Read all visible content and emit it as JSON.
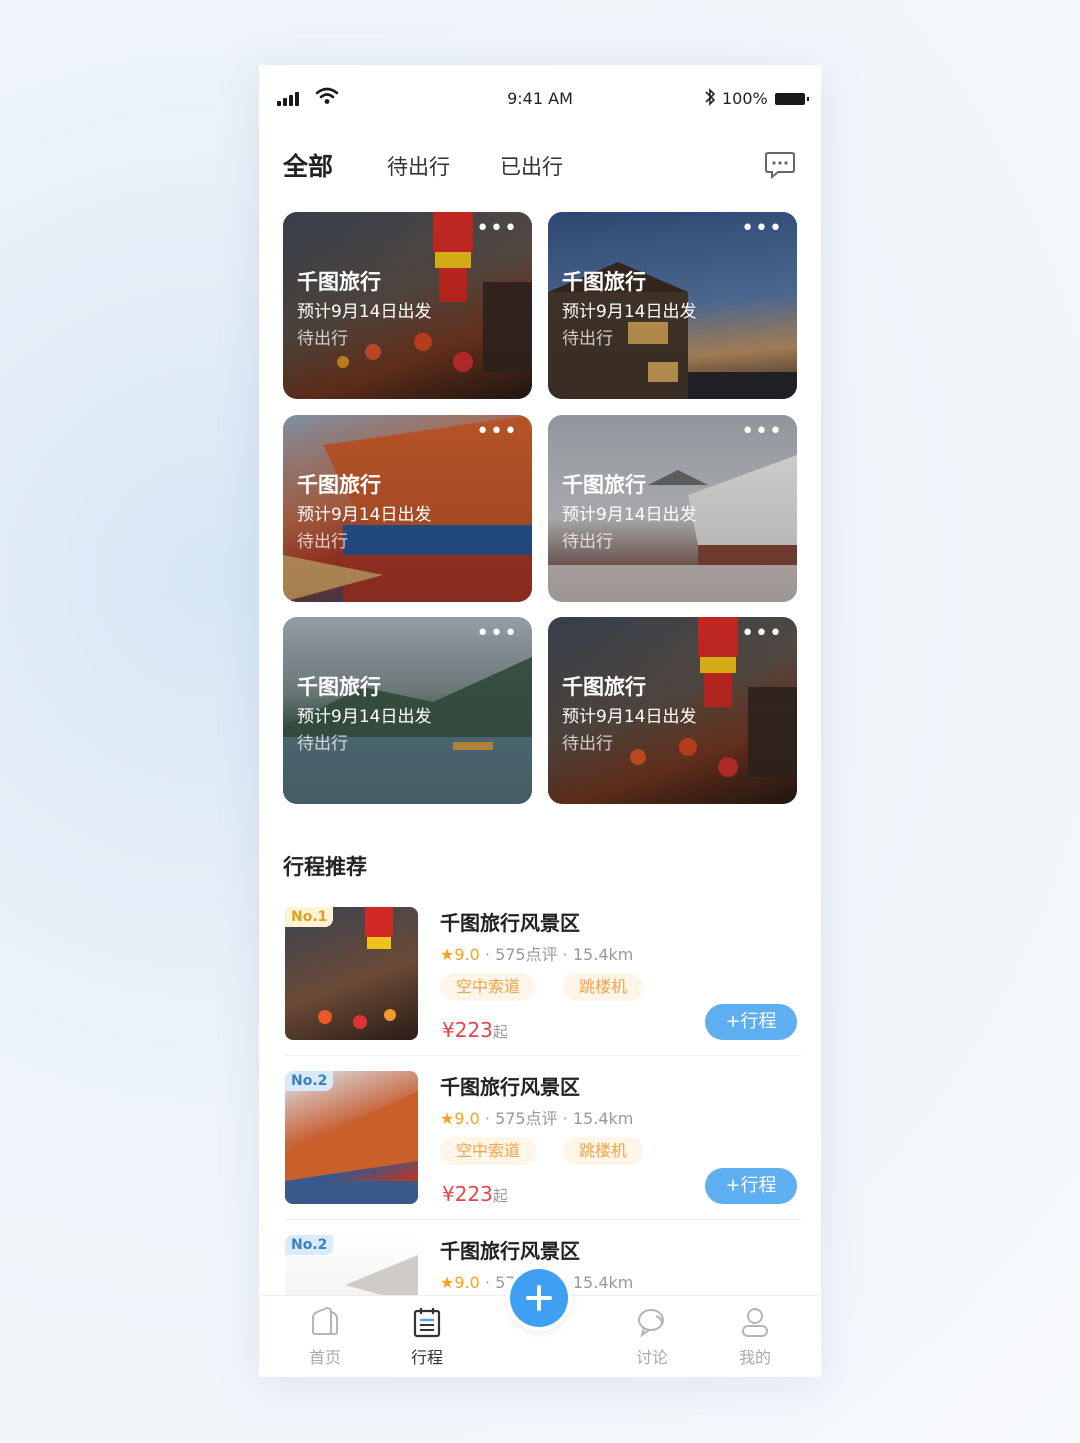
{
  "status_bar": {
    "time": "9:41 AM",
    "battery": "100%"
  },
  "tabs": [
    {
      "label": "全部",
      "active": true
    },
    {
      "label": "待出行",
      "active": false
    },
    {
      "label": "已出行",
      "active": false
    }
  ],
  "trips": [
    {
      "title": "千图旅行",
      "date": "预计9月14日出发",
      "status": "待出行"
    },
    {
      "title": "千图旅行",
      "date": "预计9月14日出发",
      "status": "待出行"
    },
    {
      "title": "千图旅行",
      "date": "预计9月14日出发",
      "status": "待出行"
    },
    {
      "title": "千图旅行",
      "date": "预计9月14日出发",
      "status": "待出行"
    },
    {
      "title": "千图旅行",
      "date": "预计9月14日出发",
      "status": "待出行"
    },
    {
      "title": "千图旅行",
      "date": "预计9月14日出发",
      "status": "待出行"
    }
  ],
  "card_menu": "•••",
  "recommend": {
    "title": "行程推荐",
    "items": [
      {
        "rank": "No.1",
        "name": "千图旅行风景区",
        "score": "9.0",
        "reviews": "575点评",
        "distance": "15.4km",
        "tags": [
          "空中索道",
          "跳楼机"
        ],
        "price": "¥223",
        "price_suffix": "起",
        "add_label": "+行程"
      },
      {
        "rank": "No.2",
        "name": "千图旅行风景区",
        "score": "9.0",
        "reviews": "575点评",
        "distance": "15.4km",
        "tags": [
          "空中索道",
          "跳楼机"
        ],
        "price": "¥223",
        "price_suffix": "起",
        "add_label": "+行程"
      },
      {
        "rank": "No.2",
        "name": "千图旅行风景区",
        "score": "9.0",
        "reviews": "575点评",
        "distance": "15.4km"
      }
    ]
  },
  "tabbar": [
    {
      "label": "首页",
      "icon": "home-icon",
      "active": false
    },
    {
      "label": "行程",
      "icon": "itinerary-icon",
      "active": true
    },
    {
      "label": "讨论",
      "icon": "chat-icon",
      "active": false
    },
    {
      "label": "我的",
      "icon": "profile-icon",
      "active": false
    }
  ],
  "colors": {
    "accent": "#3fa0f3",
    "price": "#e9434a",
    "tag_text": "#f3a447",
    "star": "#f6a21e"
  }
}
